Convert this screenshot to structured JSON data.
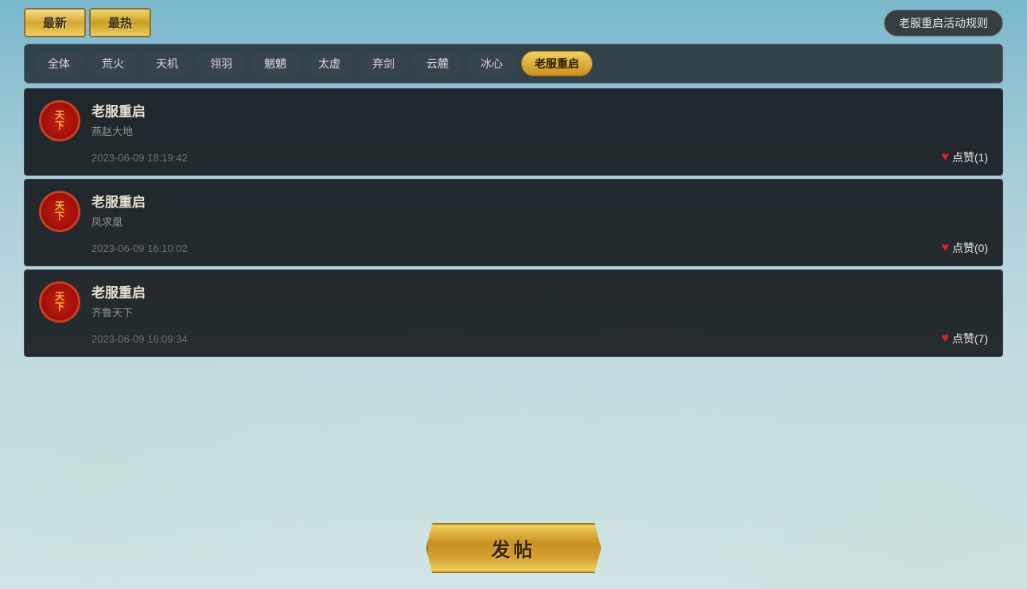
{
  "topbar": {
    "btn_newest": "最新",
    "btn_hottest": "最热",
    "rules_btn": "老服重启活动规则"
  },
  "categories": [
    {
      "id": "all",
      "label": "全体",
      "selected": false
    },
    {
      "id": "huohuo",
      "label": "荒火",
      "selected": false
    },
    {
      "id": "tianji",
      "label": "天机",
      "selected": false
    },
    {
      "id": "cuiyu",
      "label": "翎羽",
      "selected": false
    },
    {
      "id": "meimei",
      "label": "魍魉",
      "selected": false
    },
    {
      "id": "taixu",
      "label": "太虚",
      "selected": false
    },
    {
      "id": "pijian",
      "label": "弃剑",
      "selected": false
    },
    {
      "id": "yunlu",
      "label": "云麓",
      "selected": false
    },
    {
      "id": "bingxin",
      "label": "冰心",
      "selected": false
    },
    {
      "id": "laofuchongqi",
      "label": "老服重启",
      "selected": true
    }
  ],
  "posts": [
    {
      "id": 1,
      "avatar_line1": "天",
      "avatar_line2": "下",
      "title": "老服重启",
      "author": "燕赵大地",
      "time": "2023-06-09 18:19:42",
      "like_label": "点赞",
      "like_count": "(1)"
    },
    {
      "id": 2,
      "avatar_line1": "天",
      "avatar_line2": "下",
      "title": "老服重启",
      "author": "凤求凰",
      "time": "2023-06-09 16:10:02",
      "like_label": "点赞",
      "like_count": "(0)"
    },
    {
      "id": 3,
      "avatar_line1": "天",
      "avatar_line2": "下",
      "title": "老服重启",
      "author": "齐鲁天下",
      "time": "2023-06-09 16:09:34",
      "like_label": "点赞",
      "like_count": "(7)"
    }
  ],
  "post_button": {
    "label": "发帖"
  }
}
